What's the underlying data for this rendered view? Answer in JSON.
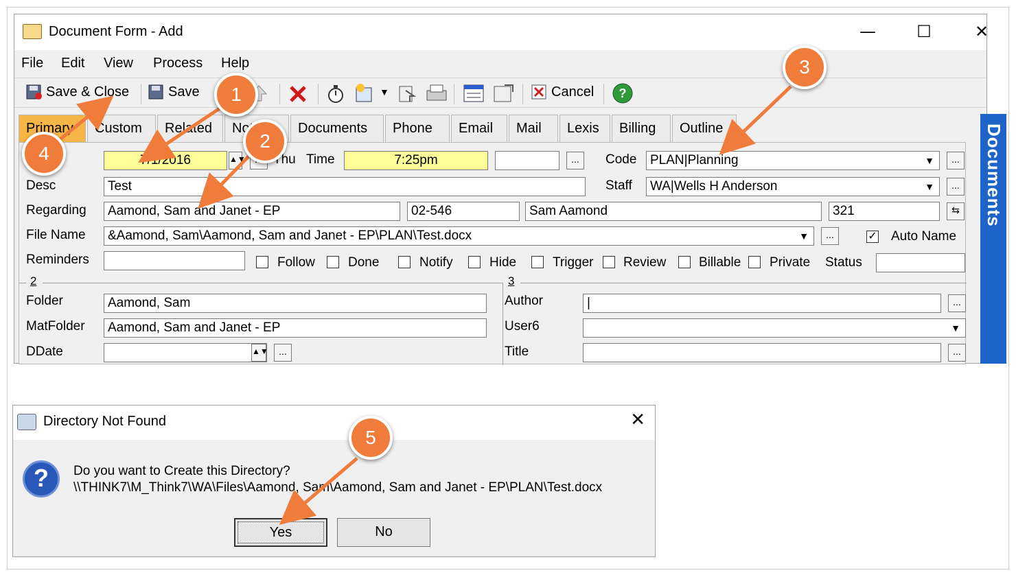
{
  "window": {
    "title": "Document Form - Add",
    "minimize": "—",
    "maximize": "☐",
    "close": "✕"
  },
  "menu": [
    "File",
    "Edit",
    "View",
    "Process",
    "Help"
  ],
  "toolbar": {
    "save_close": "Save & Close",
    "save": "Save",
    "cancel": "Cancel"
  },
  "tabs": [
    "Primary",
    "Custom",
    "Related",
    "Notes",
    "Documents",
    "Phone",
    "Email",
    "Mail",
    "Lexis",
    "Billing",
    "Outline"
  ],
  "form": {
    "date_value": "7/1/2016",
    "day_label": "Thu",
    "time_label": "Time",
    "time_value": "7:25pm",
    "code_label": "Code",
    "code_value": "PLAN|Planning",
    "desc_label": "Desc",
    "desc_value": "Test",
    "staff_label": "Staff",
    "staff_value": "WA|Wells H Anderson",
    "regarding_label": "Regarding",
    "regarding_value": "Aamond, Sam and Janet - EP",
    "matter_no": "02-546",
    "contact_value": "Sam Aamond",
    "number_value": "321",
    "filename_label": "File Name",
    "filename_value": "&Aamond, Sam\\Aamond, Sam and Janet - EP\\PLAN\\Test.docx",
    "autoname_label": "Auto Name",
    "reminders_label": "Reminders",
    "status_label": "Status",
    "checkboxes": [
      "Follow",
      "Done",
      "Notify",
      "Hide",
      "Trigger",
      "Review",
      "Billable",
      "Private"
    ],
    "section2": "2",
    "section3": "3",
    "folder_label": "Folder",
    "folder_value": "Aamond, Sam",
    "matfolder_label": "MatFolder",
    "matfolder_value": "Aamond, Sam and Janet - EP",
    "ddate_label": "DDate",
    "author_label": "Author",
    "user6_label": "User6",
    "title_label": "Title"
  },
  "sidebar": {
    "label": "Documents"
  },
  "dialog": {
    "title": "Directory Not Found",
    "close": "✕",
    "question": "Do you want to Create this Directory?",
    "path": "\\\\THINK7\\M_Think7\\WA\\Files\\Aamond, Sam\\Aamond, Sam and Janet - EP\\PLAN\\Test.docx",
    "yes": "Yes",
    "no": "No",
    "icon": "?"
  },
  "callouts": [
    "1",
    "2",
    "3",
    "4",
    "5"
  ],
  "colors": {
    "callout": "#f07c3c",
    "active_tab": "#f6b547",
    "highlight_field": "#ffff99",
    "sidebar": "#1e64c8"
  }
}
